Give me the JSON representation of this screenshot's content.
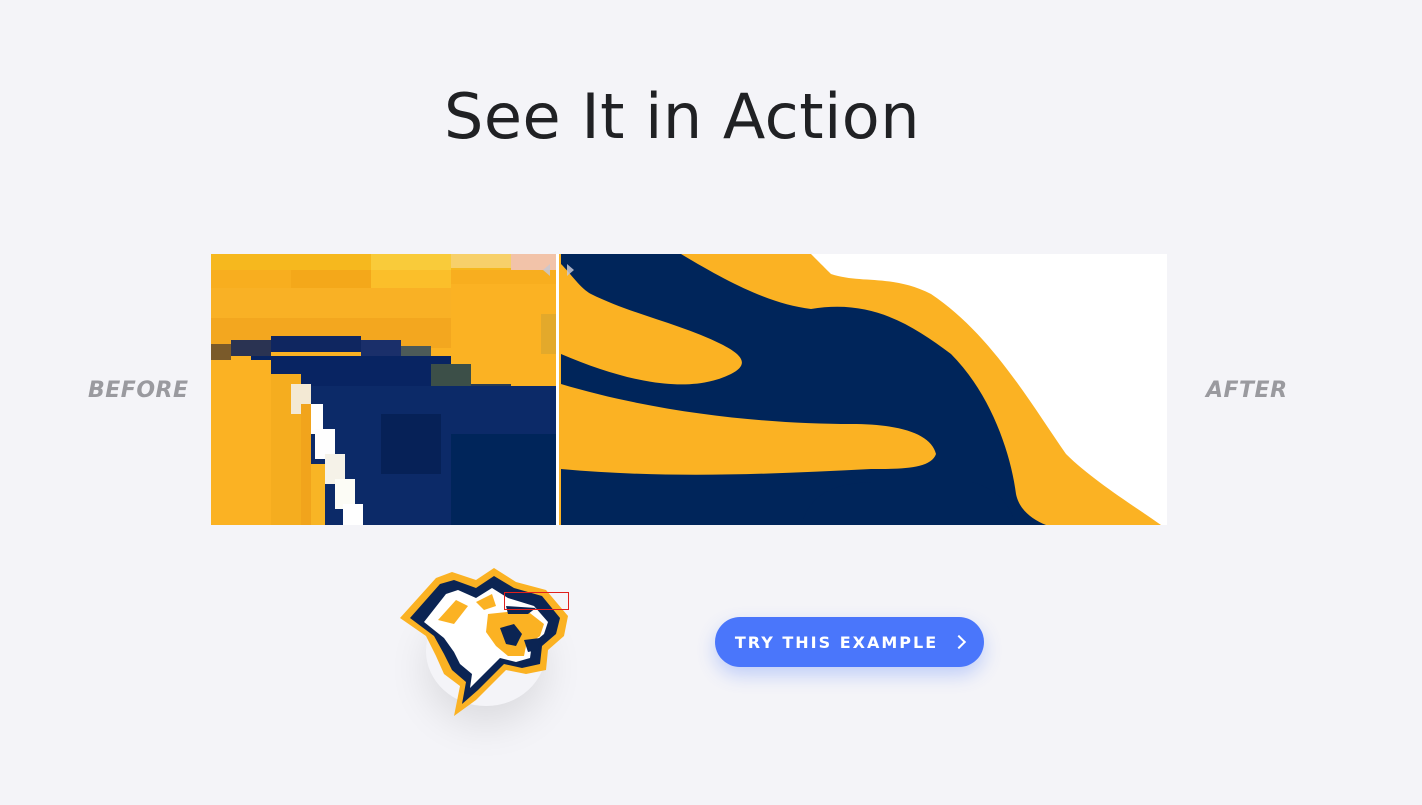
{
  "section": {
    "title": "See It in Action"
  },
  "comparison": {
    "before_label": "BEFORE",
    "after_label": "AFTER",
    "colors": {
      "gold": "#fbb223",
      "navy": "#00255a",
      "white": "#ffffff"
    }
  },
  "example": {
    "thumbnail_icon": "wildcat-mascot-logo",
    "cta_label": "TRY THIS EXAMPLE",
    "cta_icon": "chevron-right-icon",
    "cta_color": "#4a76fb"
  }
}
